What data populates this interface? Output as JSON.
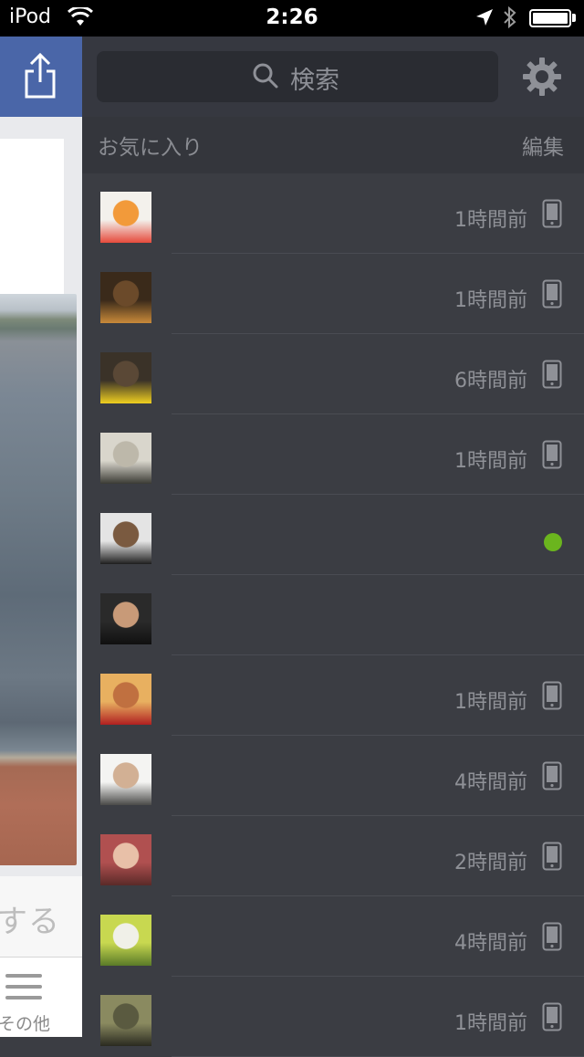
{
  "status_bar": {
    "carrier": "iPod",
    "time": "2:26"
  },
  "background_app": {
    "post_action_fragment": "する",
    "tab_other_label": "その他"
  },
  "search": {
    "placeholder": "検索"
  },
  "favorites": {
    "title": "お気に入り",
    "edit_label": "編集"
  },
  "contacts": [
    {
      "time": "1時間前",
      "indicator": "mobile-icon",
      "avatar_colors": [
        "#f3f1ec",
        "#f29a3a",
        "#e64a3b"
      ]
    },
    {
      "time": "1時間前",
      "indicator": "mobile-icon",
      "avatar_colors": [
        "#3a2a1a",
        "#6b4a2a",
        "#c98a3a"
      ]
    },
    {
      "time": "6時間前",
      "indicator": "mobile-icon",
      "avatar_colors": [
        "#3a3228",
        "#5a4836",
        "#f0d020"
      ]
    },
    {
      "time": "1時間前",
      "indicator": "mobile-icon",
      "avatar_colors": [
        "#d9d6cc",
        "#bdb8aa",
        "#3a3a34"
      ]
    },
    {
      "time": "",
      "indicator": "online-dot",
      "avatar_colors": [
        "#e4e4e4",
        "#7a5a40",
        "#1e1e1e"
      ]
    },
    {
      "time": "",
      "indicator": "",
      "avatar_colors": [
        "#2a2a2a",
        "#c89a78",
        "#101010"
      ]
    },
    {
      "time": "1時間前",
      "indicator": "mobile-icon",
      "avatar_colors": [
        "#e8b060",
        "#c07040",
        "#b02020"
      ]
    },
    {
      "time": "4時間前",
      "indicator": "mobile-icon",
      "avatar_colors": [
        "#f4f4f2",
        "#d2b094",
        "#4a4a48"
      ]
    },
    {
      "time": "2時間前",
      "indicator": "mobile-icon",
      "avatar_colors": [
        "#b05050",
        "#e8c0a8",
        "#5a2a28"
      ]
    },
    {
      "time": "4時間前",
      "indicator": "mobile-icon",
      "avatar_colors": [
        "#c8d850",
        "#f0f0e8",
        "#5a7a28"
      ]
    },
    {
      "time": "1時間前",
      "indicator": "mobile-icon",
      "avatar_colors": [
        "#8a8a60",
        "#5a5a40",
        "#2a2a20"
      ]
    }
  ],
  "colors": {
    "online": "#6bb51e",
    "panel_bg": "#3b3d43",
    "brand_blue": "#4a66a8"
  }
}
